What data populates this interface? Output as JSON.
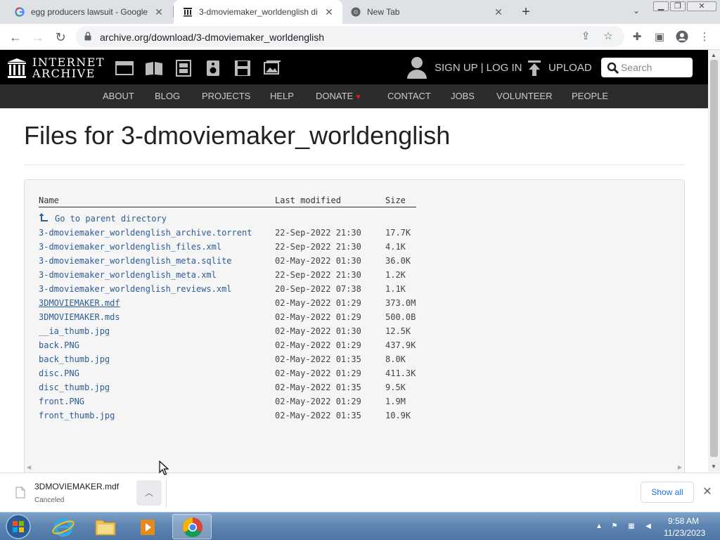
{
  "browser": {
    "tabs": [
      {
        "title": "egg producers lawsuit - Google S",
        "favicon": "google-icon",
        "active": false
      },
      {
        "title": "3-dmoviemaker_worldenglish di",
        "favicon": "internet-archive-icon",
        "active": true
      },
      {
        "title": "New Tab",
        "favicon": "chrome-icon",
        "active": false
      }
    ],
    "url": "archive.org/download/3-dmoviemaker_worldenglish"
  },
  "site": {
    "logo_line1": "INTERNET",
    "logo_line2": "ARCHIVE",
    "signup": "SIGN UP | LOG IN",
    "upload": "UPLOAD",
    "search_placeholder": "Search",
    "nav": [
      "ABOUT",
      "BLOG",
      "PROJECTS",
      "HELP",
      "DONATE",
      "CONTACT",
      "JOBS",
      "VOLUNTEER",
      "PEOPLE"
    ]
  },
  "page": {
    "title": "Files for 3-dmoviemaker_worldenglish",
    "columns": {
      "name": "Name",
      "modified": "Last modified",
      "size": "Size"
    },
    "parent_link": "Go to parent directory",
    "files": [
      {
        "name": "3-dmoviemaker_worldenglish_archive.torrent",
        "modified": "22-Sep-2022 21:30",
        "size": "17.7K"
      },
      {
        "name": "3-dmoviemaker_worldenglish_files.xml",
        "modified": "22-Sep-2022 21:30",
        "size": "4.1K"
      },
      {
        "name": "3-dmoviemaker_worldenglish_meta.sqlite",
        "modified": "02-May-2022 01:30",
        "size": "36.0K"
      },
      {
        "name": "3-dmoviemaker_worldenglish_meta.xml",
        "modified": "22-Sep-2022 21:30",
        "size": "1.2K"
      },
      {
        "name": "3-dmoviemaker_worldenglish_reviews.xml",
        "modified": "20-Sep-2022 07:38",
        "size": "1.1K"
      },
      {
        "name": "3DMOVIEMAKER.mdf",
        "modified": "02-May-2022 01:29",
        "size": "373.0M",
        "visited": true
      },
      {
        "name": "3DMOVIEMAKER.mds",
        "modified": "02-May-2022 01:29",
        "size": "500.0B"
      },
      {
        "name": "__ia_thumb.jpg",
        "modified": "02-May-2022 01:30",
        "size": "12.5K"
      },
      {
        "name": "back.PNG",
        "modified": "02-May-2022 01:29",
        "size": "437.9K"
      },
      {
        "name": "back_thumb.jpg",
        "modified": "02-May-2022 01:35",
        "size": "8.0K"
      },
      {
        "name": "disc.PNG",
        "modified": "02-May-2022 01:29",
        "size": "411.3K"
      },
      {
        "name": "disc_thumb.jpg",
        "modified": "02-May-2022 01:35",
        "size": "9.5K"
      },
      {
        "name": "front.PNG",
        "modified": "02-May-2022 01:29",
        "size": "1.9M"
      },
      {
        "name": "front_thumb.jpg",
        "modified": "02-May-2022 01:35",
        "size": "10.9K"
      }
    ]
  },
  "download": {
    "filename": "3DMOVIEMAKER.mdf",
    "status": "Canceled",
    "show_all": "Show all"
  },
  "taskbar": {
    "time": "9:58 AM",
    "date": "11/23/2023"
  },
  "colors": {
    "link": "#2c5d94",
    "ia_header": "#000000",
    "ia_nav": "#2c2c2c",
    "donate_heart": "#e0162b",
    "show_all": "#1a73e8"
  }
}
